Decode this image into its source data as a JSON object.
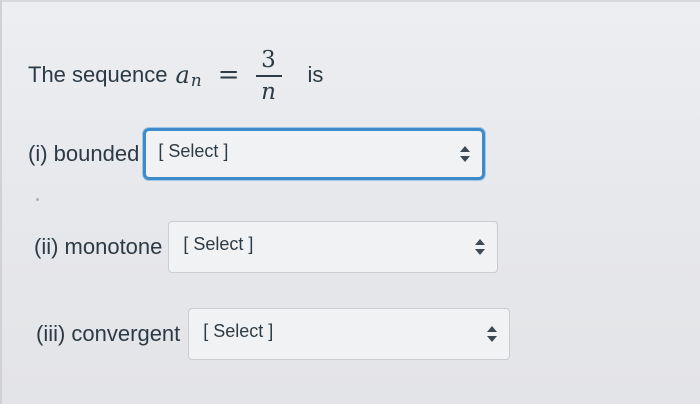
{
  "question": {
    "lead": "The sequence",
    "var": "a",
    "sub": "n",
    "equals": "=",
    "numerator": "3",
    "denominator": "n",
    "tail": "is"
  },
  "rows": [
    {
      "label": "(i) bounded",
      "select_value": "[ Select ]"
    },
    {
      "label": "(ii) monotone",
      "select_value": "[ Select ]"
    },
    {
      "label": "(iii) convergent",
      "select_value": "[ Select ]"
    }
  ],
  "icons": {
    "dropdown": "up-down-chevron-icon"
  },
  "colors": {
    "focus_border": "#3f8bc9",
    "text": "#2b3a44",
    "select_bg": "#f1f2f4"
  }
}
